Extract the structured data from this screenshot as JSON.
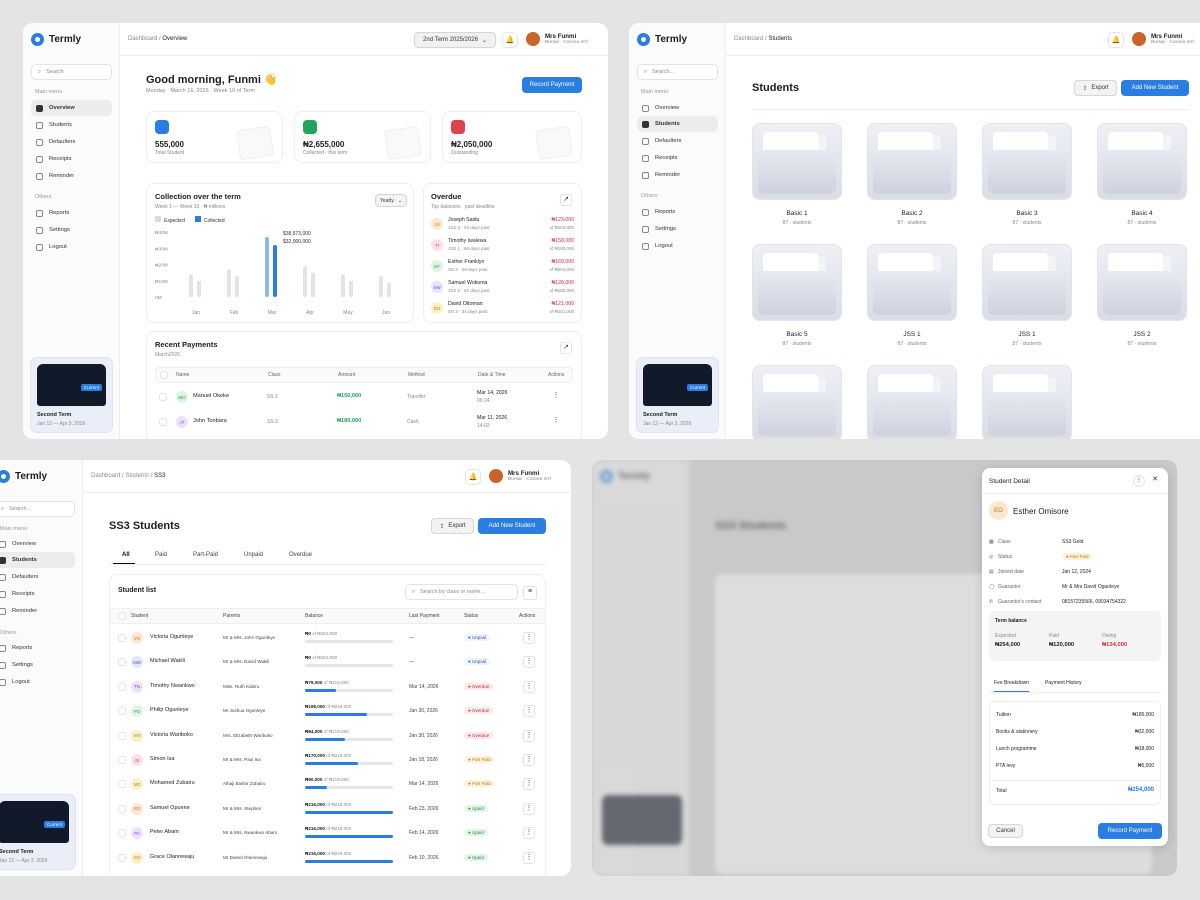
{
  "brand": "Termly",
  "user": {
    "name": "Mrs Funmi",
    "role": "Bursar · Corona Int'l"
  },
  "nav": {
    "main_menu": "Main menu",
    "others": "Others",
    "overview": "Overview",
    "students": "Students",
    "defaulters": "Defaulters",
    "receipts": "Receipts",
    "reminder": "Reminder",
    "reports": "Reports",
    "settings": "Settings",
    "logout": "Logout"
  },
  "term_card": {
    "badge": "Current",
    "name": "Second Term",
    "dates": "Jan 12 — Apr 3, 2026"
  },
  "search": {
    "placeholder_short": "Search",
    "placeholder": "Search..."
  },
  "overview": {
    "crumb_root": "Dashboard",
    "crumb_current": "Overview",
    "term_select": "2nd Term 2025/2026",
    "greeting": "Good morning, Funmi 👋",
    "date_line": "Monday · March 16, 2026 · Week 10 of Term",
    "record_payment": "Record Payment",
    "stats": [
      {
        "value": "555,000",
        "label": "Total Student",
        "color": "#2a7de1"
      },
      {
        "value": "₦2,655,000",
        "label": "Collected · this term",
        "color": "#22a45d"
      },
      {
        "value": "₦2,050,000",
        "label": "Outstanding",
        "color": "#e0424b"
      }
    ],
    "collection": {
      "title": "Collection over the term",
      "subtitle": "Week 1 — Week 10 · ₦ millions",
      "period": "Yearly",
      "legend_expected": "Expected",
      "legend_collected": "Collected",
      "tooltip_1": "$38,673,000",
      "tooltip_2": "$32,000,000"
    },
    "overdue": {
      "title": "Overdue",
      "subtitle": "Top balances · past deadline",
      "items": [
        {
          "initials": "JS",
          "name": "Joseph Saidu",
          "meta": "JSS 3 · 64 days past",
          "amount": "₦123,000",
          "of": "of ₦163,000",
          "bg": "#fde8cf",
          "fg": "#c07a1a"
        },
        {
          "initials": "TI",
          "name": "Timothy Iwalewa",
          "meta": "JSS 1 · 66 days past",
          "amount": "₦158,000",
          "of": "of ₦180,000",
          "bg": "#fde0e6",
          "fg": "#c2455e"
        },
        {
          "initials": "EF",
          "name": "Esther Franklyn",
          "meta": "SS 3 · 59 days past",
          "amount": "₦169,000",
          "of": "of ₦254,000",
          "bg": "#def5e4",
          "fg": "#2e9a53"
        },
        {
          "initials": "SW",
          "name": "Samuel Wokoma",
          "meta": "JSS 2 · 51 days past",
          "amount": "₦128,000",
          "of": "of ₦180,000",
          "bg": "#ece1fb",
          "fg": "#7e4bc9"
        },
        {
          "initials": "DO",
          "name": "David Ottoman",
          "meta": "SS 3 · 34 days past",
          "amount": "₦121,000",
          "of": "of ₦151,000",
          "bg": "#fdf0c8",
          "fg": "#b08610"
        }
      ]
    },
    "recent": {
      "title": "Recent Payments",
      "subtitle": "March2026",
      "columns": [
        "Name",
        "Class",
        "Amount",
        "Method",
        "Date & Time",
        "Actions"
      ],
      "rows": [
        {
          "initials": "MO",
          "name": "Manuel Okeke",
          "class": "SS 2",
          "amount": "₦150,000",
          "method": "Transfer",
          "date": "Mar 14, 2026",
          "time": "09:24",
          "bg": "#def5e4",
          "fg": "#2e9a53"
        },
        {
          "initials": "JT",
          "name": "John Tonbara",
          "class": "SS 3",
          "amount": "₦180,000",
          "method": "Cash",
          "date": "Mar 11, 2026",
          "time": "14:02",
          "bg": "#ece1fb",
          "fg": "#7e4bc9"
        }
      ]
    }
  },
  "chart_data": {
    "type": "bar",
    "categories": [
      "Jan",
      "Feb",
      "Mar",
      "Apr",
      "May",
      "Jun"
    ],
    "ytick_labels": [
      "₦40M",
      "₦30M",
      "₦20M",
      "₦10M",
      "0M"
    ],
    "ylim": [
      0,
      40
    ],
    "series": [
      {
        "name": "Expected",
        "values": [
          14,
          17,
          37,
          19,
          14,
          13
        ]
      },
      {
        "name": "Collected",
        "values": [
          10,
          13,
          32,
          15,
          10,
          9
        ]
      }
    ]
  },
  "students": {
    "crumb_root": "Dashboard",
    "crumb_current": "Students",
    "title": "Students",
    "export": "Export",
    "add": "Add New Student",
    "classes": [
      {
        "name": "Basic 1",
        "count": "87 · students"
      },
      {
        "name": "Basic 2",
        "count": "87 · students"
      },
      {
        "name": "Basic 3",
        "count": "87 · students"
      },
      {
        "name": "Basic 4",
        "count": "87 · students"
      },
      {
        "name": "Basic 5",
        "count": "87 · students"
      },
      {
        "name": "JSS 1",
        "count": "87 · students"
      },
      {
        "name": "JSS 1",
        "count": "87 · students"
      },
      {
        "name": "JSS 2",
        "count": "87 · students"
      }
    ]
  },
  "ss3": {
    "crumb_root": "Dashboard",
    "crumb_mid": "Students",
    "crumb_current": "SS3",
    "title": "SS3 Students",
    "export": "Export",
    "add": "Add New Student",
    "tabs": [
      "All",
      "Paid",
      "Part-Paid",
      "Unpaid",
      "Overdue"
    ],
    "list_title": "Student list",
    "search_placeholder": "Search by class or name...",
    "columns": [
      "Student",
      "Parents",
      "Balance",
      "Last Payment",
      "Status",
      "Actions"
    ],
    "rows": [
      {
        "initials": "VO",
        "name": "Victoria Ogunleye",
        "parent": "Mr & Mrs. John Ogunleye",
        "bal": "₦0",
        "of": "of ₦264,000",
        "pct": 0,
        "last": "—",
        "status": "Unpaid",
        "bg": "#fde8cf",
        "fg": "#c07a1a"
      },
      {
        "initials": "MW",
        "name": "Michael Wakili",
        "parent": "Mr & Mrs. David Wakili",
        "bal": "₦0",
        "of": "of ₦264,000",
        "pct": 0,
        "last": "—",
        "status": "Unpaid",
        "bg": "#e1e8fb",
        "fg": "#4566c9"
      },
      {
        "initials": "TN",
        "name": "Timothy Nwankwo",
        "parent": "Miss. Ruth Kabiru",
        "bal": "₦79,000",
        "of": "of ₦218,000",
        "pct": 35,
        "last": "Mar 14, 2026",
        "status": "Overdue",
        "bg": "#ece1fb",
        "fg": "#7e4bc9"
      },
      {
        "initials": "PO",
        "name": "Philip Ogunleye",
        "parent": "Mr Joshua Ogunleye",
        "bal": "₦198,000",
        "of": "of ₦216,000",
        "pct": 70,
        "last": "Jan 30, 2026",
        "status": "Overdue",
        "bg": "#def5e4",
        "fg": "#2e9a53"
      },
      {
        "initials": "VW",
        "name": "Victoria Wariboko",
        "parent": "Mrs. Elizabeth Wariboko",
        "bal": "₦84,000",
        "of": "of ₦218,000",
        "pct": 45,
        "last": "Jan 30, 2026",
        "status": "Overdue",
        "bg": "#fdf0c8",
        "fg": "#b08610"
      },
      {
        "initials": "SI",
        "name": "Simon Isa",
        "parent": "Mr & Mrs. Paul Isa",
        "bal": "₦170,000",
        "of": "of ₦216,000",
        "pct": 60,
        "last": "Jan 18, 2026",
        "status": "Part Paid",
        "bg": "#fde0e6",
        "fg": "#c2455e"
      },
      {
        "initials": "MZ",
        "name": "Mohamed Zubairu",
        "parent": "Alhaji Bashir Zubairu",
        "bal": "₦50,000",
        "of": "of ₦218,000",
        "pct": 25,
        "last": "Mar 14, 2026",
        "status": "Part Paid",
        "bg": "#fdf0c8",
        "fg": "#b08610"
      },
      {
        "initials": "SO",
        "name": "Samuel Opuene",
        "parent": "Mr & Mrs. Stephen",
        "bal": "₦216,000",
        "of": "of ₦218,000",
        "pct": 100,
        "last": "Feb 23, 2026",
        "status": "Upaid",
        "bg": "#fde8cf",
        "fg": "#c07a1a"
      },
      {
        "initials": "PA",
        "name": "Peter Abam",
        "parent": "Mr & Mrs. Nwankwo Abam",
        "bal": "₦216,000",
        "of": "of ₦218,000",
        "pct": 100,
        "last": "Feb 14, 2026",
        "status": "Upaid",
        "bg": "#ece1fb",
        "fg": "#7e4bc9"
      },
      {
        "initials": "GO",
        "name": "Grace Olanrewaju",
        "parent": "Mr Daniel Olanrewaju",
        "bal": "₦216,000",
        "of": "of ₦216,000",
        "pct": 100,
        "last": "Feb 10, 2026",
        "status": "Upaid",
        "bg": "#fdf0c8",
        "fg": "#b08610"
      }
    ]
  },
  "detail": {
    "title": "Student Detail",
    "initials": "EO",
    "name": "Esther Omisore",
    "fields": [
      {
        "k": "Class",
        "v": "SS3 Gold"
      },
      {
        "k": "Status",
        "v": "Part Paid"
      },
      {
        "k": "Joined date",
        "v": "Jan 12, 2024"
      },
      {
        "k": "Guarantor",
        "v": "Mr & Mrs David Ogunleye"
      },
      {
        "k": "Guarantor's contact",
        "v": "08157235566, 09034754322"
      }
    ],
    "term_balance": "Term balance",
    "expected_label": "Expected",
    "expected": "₦254,000",
    "paid_label": "Paid",
    "paid": "₦120,000",
    "owing_label": "Owing",
    "owing": "₦134,000",
    "tab_fee": "Fee Breakdown",
    "tab_history": "Payment History",
    "fees": [
      {
        "k": "Tuition",
        "v": "₦185,000"
      },
      {
        "k": "Books & stationery",
        "v": "₦32,000"
      },
      {
        "k": "Lunch programme",
        "v": "₦18,000"
      },
      {
        "k": "PTA levy",
        "v": "₦5,000"
      }
    ],
    "total_label": "Total",
    "total": "₦254,000",
    "cancel": "Cancel",
    "record": "Record Payment"
  }
}
